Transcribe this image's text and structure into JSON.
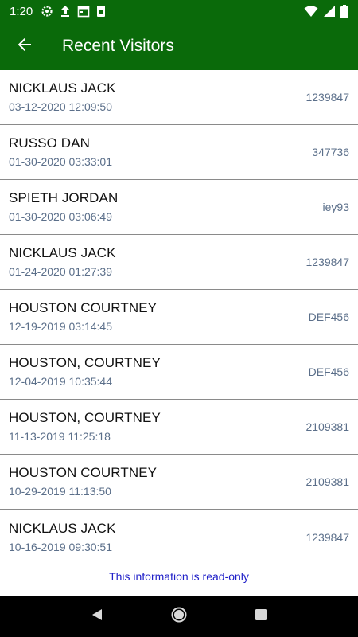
{
  "status_bar": {
    "time": "1:20",
    "left_icons": [
      "settings-icon",
      "upload-icon",
      "calendar-icon",
      "sim-card-icon"
    ],
    "right_icons": [
      "wifi-icon",
      "signal-icon",
      "battery-icon"
    ]
  },
  "app_bar": {
    "title": "Recent Visitors",
    "back_icon": "arrow-back-icon"
  },
  "visitors": [
    {
      "name": "NICKLAUS JACK",
      "date": "03-12-2020 12:09:50",
      "id": "1239847"
    },
    {
      "name": "RUSSO DAN",
      "date": "01-30-2020 03:33:01",
      "id": "347736"
    },
    {
      "name": "SPIETH JORDAN",
      "date": "01-30-2020 03:06:49",
      "id": "iey93"
    },
    {
      "name": "NICKLAUS JACK",
      "date": "01-24-2020 01:27:39",
      "id": "1239847"
    },
    {
      "name": "HOUSTON COURTNEY",
      "date": "12-19-2019 03:14:45",
      "id": "DEF456"
    },
    {
      "name": "HOUSTON, COURTNEY",
      "date": "12-04-2019 10:35:44",
      "id": "DEF456"
    },
    {
      "name": "HOUSTON, COURTNEY",
      "date": "11-13-2019 11:25:18",
      "id": "2109381"
    },
    {
      "name": "HOUSTON COURTNEY",
      "date": "10-29-2019 11:13:50",
      "id": "2109381"
    },
    {
      "name": "NICKLAUS JACK",
      "date": "10-16-2019 09:30:51",
      "id": "1239847"
    }
  ],
  "footer": {
    "note": "This information is read-only"
  },
  "nav_bar": {
    "buttons": [
      "back-triangle-icon",
      "home-circle-icon",
      "recents-square-icon"
    ]
  },
  "colors": {
    "primary": "#0a6a0a",
    "secondary_text": "#5b6f8a",
    "note_text": "#2020c8"
  }
}
